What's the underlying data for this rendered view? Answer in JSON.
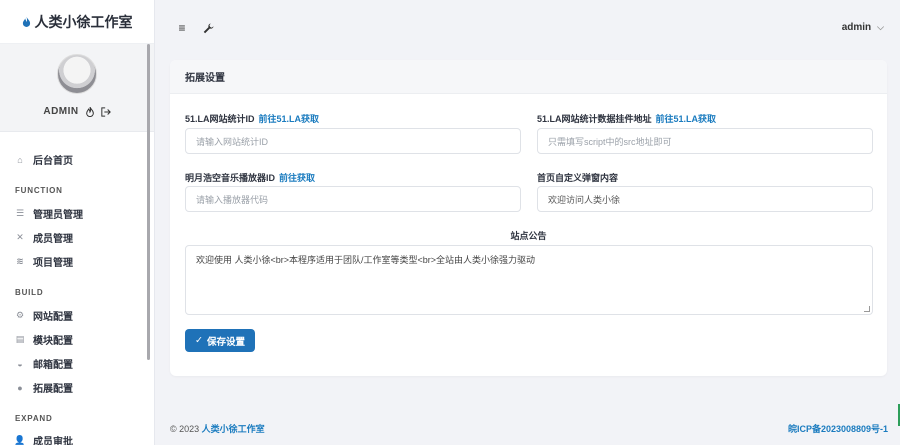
{
  "brand": {
    "name": "人类小徐工作室"
  },
  "profile": {
    "username": "ADMIN"
  },
  "nav": {
    "home": "后台首页",
    "section_function": "FUNCTION",
    "admin_mgmt": "管理员管理",
    "member_mgmt": "成员管理",
    "project_mgmt": "项目管理",
    "section_build": "BUILD",
    "site_config": "网站配置",
    "module_config": "模块配置",
    "mail_config": "邮箱配置",
    "ext_config": "拓展配置",
    "section_expand": "EXPAND",
    "member_review": "成员审批"
  },
  "header": {
    "user": "admin"
  },
  "card": {
    "title": "拓展设置",
    "la_id_label": "51.LA网站统计ID",
    "la_id_link": "前往51.LA获取",
    "la_id_placeholder": "请输入网站统计ID",
    "la_widget_label": "51.LA网站统计数据挂件地址",
    "la_widget_link": "前往51.LA获取",
    "la_widget_placeholder": "只需填写script中的src地址即可",
    "music_label": "明月浩空音乐播放器ID",
    "music_link": "前往获取",
    "music_placeholder": "请输入播放器代码",
    "popup_label": "首页自定义弹窗内容",
    "popup_value": "欢迎访问人类小徐",
    "notice_label": "站点公告",
    "notice_value": "欢迎使用 人类小徐<br>本程序适用于团队/工作室等类型<br>全站由人类小徐强力驱动",
    "save_label": "保存设置"
  },
  "footer": {
    "copyright": "© 2023",
    "brand_link": "人类小徐工作室",
    "icp": "皖ICP备2023008809号-1"
  },
  "colors": {
    "accent": "#1f72b8",
    "link": "#1a7bbf",
    "background": "#f2f3f7"
  }
}
